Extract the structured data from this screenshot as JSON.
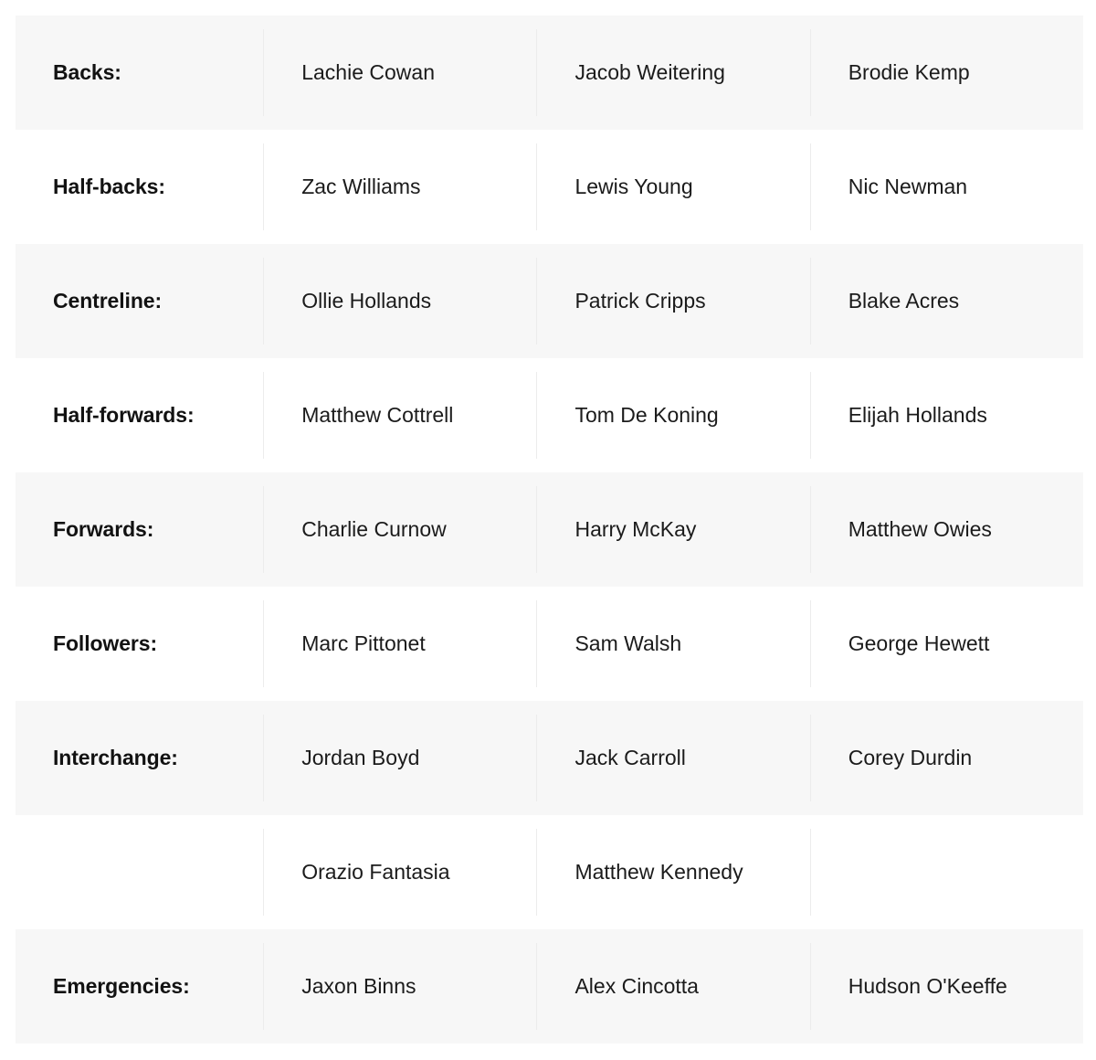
{
  "team_sheet": {
    "columns": [
      "position",
      "player_1",
      "player_2",
      "player_3"
    ],
    "rows": [
      {
        "shaded": true,
        "position": "Backs:",
        "players": [
          "Lachie Cowan",
          "Jacob Weitering",
          "Brodie Kemp"
        ]
      },
      {
        "shaded": false,
        "position": "Half-backs:",
        "players": [
          "Zac Williams",
          "Lewis Young",
          "Nic Newman"
        ]
      },
      {
        "shaded": true,
        "position": "Centreline:",
        "players": [
          "Ollie Hollands",
          "Patrick Cripps",
          "Blake Acres"
        ]
      },
      {
        "shaded": false,
        "position": "Half-forwards:",
        "players": [
          "Matthew Cottrell",
          "Tom De Koning",
          "Elijah Hollands"
        ]
      },
      {
        "shaded": true,
        "position": "Forwards:",
        "players": [
          "Charlie Curnow",
          "Harry McKay",
          "Matthew Owies"
        ]
      },
      {
        "shaded": false,
        "position": "Followers:",
        "players": [
          "Marc Pittonet",
          "Sam Walsh",
          "George Hewett"
        ]
      },
      {
        "shaded": true,
        "position": "Interchange:",
        "players": [
          "Jordan Boyd",
          "Jack Carroll",
          "Corey Durdin"
        ]
      },
      {
        "shaded": false,
        "position": "",
        "players": [
          "Orazio Fantasia",
          "Matthew Kennedy",
          ""
        ]
      },
      {
        "shaded": true,
        "position": "Emergencies:",
        "players": [
          "Jaxon Binns",
          "Alex Cincotta",
          "Hudson O'Keeffe"
        ]
      }
    ]
  },
  "colors": {
    "row_shaded_bg": "#f7f7f7",
    "row_plain_bg": "#ffffff",
    "divider": "#ececec",
    "label_text": "#121212",
    "body_text": "#1b1b1b",
    "page_bg": "#ffffff"
  }
}
